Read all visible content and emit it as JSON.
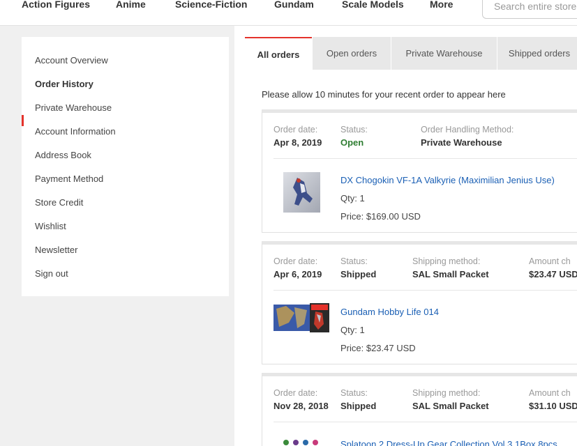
{
  "nav": {
    "items": [
      "Action Figures",
      "Anime",
      "Science-Fiction",
      "Gundam",
      "Scale Models",
      "More"
    ],
    "search_placeholder": "Search entire store"
  },
  "sidebar": {
    "items": [
      "Account Overview",
      "Order History",
      "Private Warehouse",
      "Account Information",
      "Address Book",
      "Payment Method",
      "Store Credit",
      "Wishlist",
      "Newsletter",
      "Sign out"
    ],
    "active_index": 1
  },
  "tabs": [
    "All orders",
    "Open orders",
    "Private Warehouse",
    "Shipped orders"
  ],
  "notice": "Please allow 10 minutes for your recent order to appear here",
  "labels": {
    "order_date": "Order date:",
    "status": "Status:",
    "handling": "Order Handling Method:",
    "shipping": "Shipping method:",
    "amount": "Amount ch"
  },
  "orders": [
    {
      "date": "Apr 8, 2019",
      "status": "Open",
      "handling": "Private Warehouse",
      "product": "DX Chogokin VF-1A Valkyrie (Maximilian Jenius Use)",
      "qty": "Qty: 1",
      "price": "Price: $169.00 USD"
    },
    {
      "date": "Apr 6, 2019",
      "status": "Shipped",
      "shipping": "SAL Small Packet",
      "amount": "$23.47 USD",
      "product": "Gundam Hobby Life 014",
      "qty": "Qty: 1",
      "price": "Price: $23.47 USD"
    },
    {
      "date": "Nov 28, 2018",
      "status": "Shipped",
      "shipping": "SAL Small Packet",
      "amount": "$31.10 USD",
      "product": "Splatoon 2 Dress-Up Gear Collection Vol.3 1Box 8pcs"
    }
  ],
  "colors": {
    "accent": "#e4322b",
    "link": "#1a5fb4",
    "open_status": "#2f7d32"
  }
}
